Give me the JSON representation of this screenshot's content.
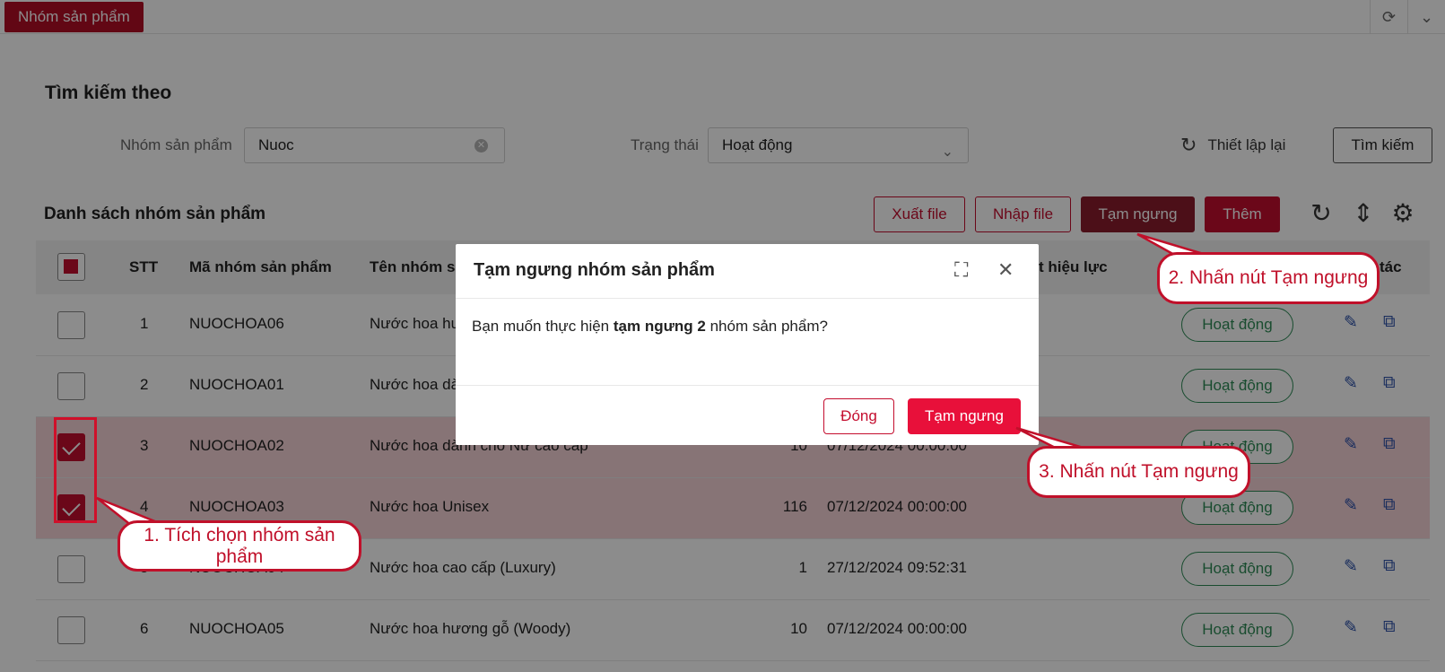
{
  "topbar": {
    "active_tab": "Nhóm sản phẩm"
  },
  "search": {
    "title": "Tìm kiếm theo",
    "group_label": "Nhóm sản phẩm",
    "group_value": "Nuoc",
    "status_label": "Trạng thái",
    "status_value": "Hoạt động",
    "reset_label": "Thiết lập lại",
    "search_label": "Tìm kiếm"
  },
  "list": {
    "title": "Danh sách nhóm sản phẩm",
    "export_label": "Xuất file",
    "import_label": "Nhập file",
    "suspend_label": "Tạm ngưng",
    "add_label": "Thêm"
  },
  "table": {
    "headers": [
      "STT",
      "Mã nhóm sản phẩm",
      "Tên nhóm sả",
      "t hiệu lực",
      "tác"
    ],
    "rows": [
      {
        "stt": "1",
        "code": "NUOCHOA06",
        "name": "Nước hoa hư",
        "count": "",
        "date": "",
        "status": "Hoạt động",
        "selected": false
      },
      {
        "stt": "2",
        "code": "NUOCHOA01",
        "name": "Nước hoa dà",
        "count": "",
        "date": "",
        "status": "Hoạt động",
        "selected": false
      },
      {
        "stt": "3",
        "code": "NUOCHOA02",
        "name": "Nước hoa dành cho Nữ cao cấp",
        "count": "10",
        "date": "07/12/2024 00:00:00",
        "status": "Hoạt động",
        "selected": true
      },
      {
        "stt": "4",
        "code": "NUOCHOA03",
        "name": "Nước hoa Unisex",
        "count": "116",
        "date": "07/12/2024 00:00:00",
        "status": "Hoạt động",
        "selected": true
      },
      {
        "stt": "5",
        "code": "NUOCHOA04",
        "name": "Nước hoa cao cấp (Luxury)",
        "count": "1",
        "date": "27/12/2024 09:52:31",
        "status": "Hoạt động",
        "selected": false
      },
      {
        "stt": "6",
        "code": "NUOCHOA05",
        "name": "Nước hoa hương gỗ (Woody)",
        "count": "10",
        "date": "07/12/2024 00:00:00",
        "status": "Hoạt động",
        "selected": false
      }
    ]
  },
  "modal": {
    "title": "Tạm ngưng nhóm sản phẩm",
    "body_prefix": "Bạn muốn thực hiện ",
    "body_bold": "tạm ngưng 2",
    "body_suffix": " nhóm sản phẩm?",
    "close_label": "Đóng",
    "confirm_label": "Tạm ngưng"
  },
  "callouts": {
    "step1": "1. Tích chọn nhóm sản phẩm",
    "step2": "2. Nhấn nút Tạm ngưng",
    "step3": "3. Nhấn nút Tạm ngưng"
  },
  "colors": {
    "brand": "#c40d2e",
    "status_green": "#2e8b57",
    "callout_red": "#c0102a"
  },
  "icons": [
    "refresh-icon",
    "chevron-down-icon",
    "clear-icon",
    "reset-icon",
    "reload-icon",
    "column-height-icon",
    "settings-icon",
    "edit-icon",
    "copy-icon",
    "expand-icon",
    "close-icon"
  ]
}
